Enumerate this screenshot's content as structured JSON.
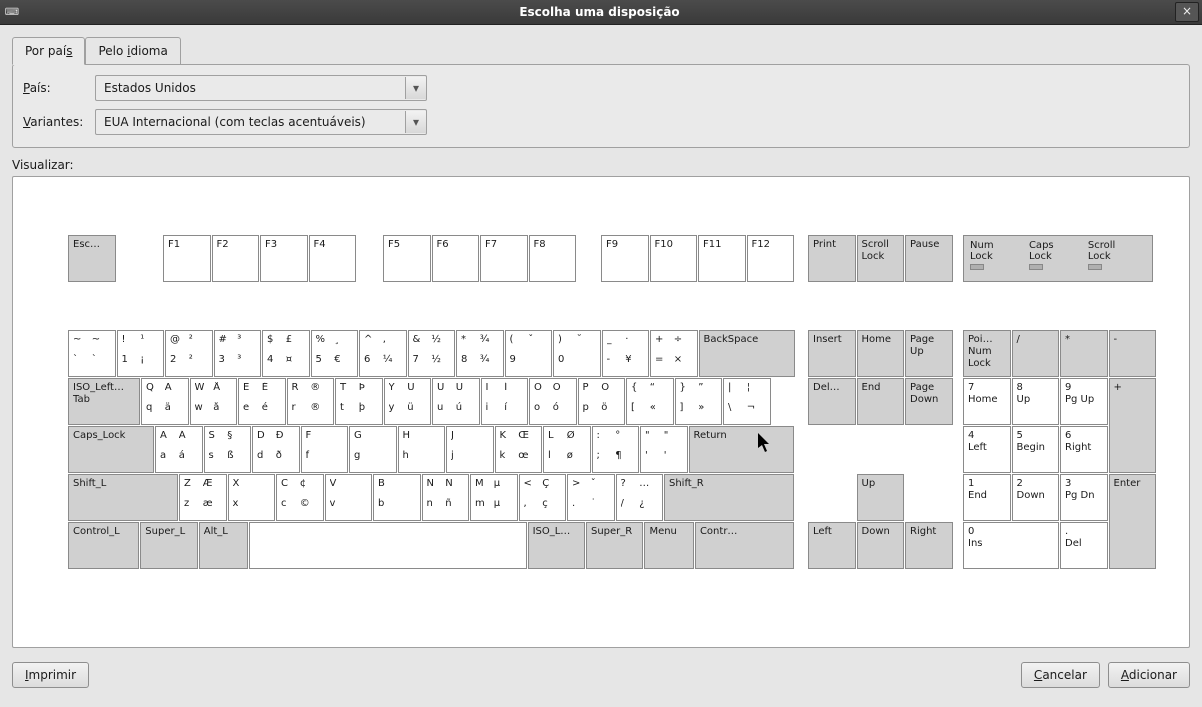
{
  "window": {
    "title": "Escolha uma disposição",
    "icon": "⌨"
  },
  "tabs": {
    "country": "Por país",
    "language": "Pelo idioma"
  },
  "form": {
    "country_label": "País:",
    "variant_label": "Variantes:",
    "country_value": "Estados Unidos",
    "variant_value": "EUA Internacional (com teclas acentuáveis)"
  },
  "preview_label": "Visualizar:",
  "lock_panel": {
    "num": "Num\nLock",
    "caps": "Caps\nLock",
    "scroll": "Scroll\nLock"
  },
  "keys": {
    "esc": "Esc…",
    "f1": "F1",
    "f2": "F2",
    "f3": "F3",
    "f4": "F4",
    "f5": "F5",
    "f6": "F6",
    "f7": "F7",
    "f8": "F8",
    "f9": "F9",
    "f10": "F10",
    "f11": "F11",
    "f12": "F12",
    "print": "Print",
    "slock": "Scroll\nLock",
    "pause": "Pause",
    "bksp": "BackSpace",
    "tab": "ISO_Left…\nTab",
    "caps": "Caps_Lock",
    "ret": "Return",
    "lshift": "Shift_L",
    "rshift": "Shift_R",
    "lctrl": "Control_L",
    "lsuper": "Super_L",
    "lalt": "Alt_L",
    "isolg": "ISO_L…",
    "rsuper": "Super_R",
    "menu": "Menu",
    "rctrl": "Contr…",
    "ins": "Insert",
    "home": "Home",
    "pgup": "Page\nUp",
    "del": "Del…",
    "end": "End",
    "pgdn": "Page\nDown",
    "up": "Up",
    "left": "Left",
    "down": "Down",
    "right": "Right",
    "numlock": "Poi…\nNum\nLock",
    "kdiv": "/",
    "kmul": "*",
    "ksub": "-",
    "kp7": "7\nHome",
    "kp8": "8\nUp",
    "kp9": "9\nPg Up",
    "kadd": "+",
    "kp4": "4\nLeft",
    "kp5": "5\nBegin",
    "kp6": "6\nRight",
    "kp1": "1\nEnd",
    "kp2": "2\nDown",
    "kp3": "3\nPg Dn",
    "kent": "Enter",
    "kp0": "0\nIns",
    "kpdot": ".\nDel"
  },
  "main_rows": {
    "r1": [
      [
        "~",
        "~",
        "`",
        "`"
      ],
      [
        "!",
        "¹",
        "1",
        "¡"
      ],
      [
        "@",
        "²",
        "2",
        "²"
      ],
      [
        "#",
        "³",
        "3",
        "³"
      ],
      [
        "$",
        "£",
        "4",
        "¤"
      ],
      [
        "%",
        "¸",
        "5",
        "€"
      ],
      [
        "^",
        ",",
        "6",
        "¼"
      ],
      [
        "&",
        "½",
        "7",
        "½"
      ],
      [
        "*",
        "¾",
        "8",
        "¾"
      ],
      [
        "(",
        "ˇ",
        "9",
        ""
      ],
      [
        ")",
        "˘",
        "0",
        ""
      ],
      [
        "_",
        "·",
        "-",
        "¥"
      ],
      [
        "+",
        "÷",
        "=",
        "×"
      ]
    ],
    "r2": [
      [
        "Q",
        "Ä",
        "q",
        "ä"
      ],
      [
        "W",
        "Å",
        "w",
        "å"
      ],
      [
        "E",
        "É",
        "e",
        "é"
      ],
      [
        "R",
        "®",
        "r",
        "®"
      ],
      [
        "T",
        "Þ",
        "t",
        "þ"
      ],
      [
        "Y",
        "Ü",
        "y",
        "ü"
      ],
      [
        "U",
        "Ú",
        "u",
        "ú"
      ],
      [
        "I",
        "Í",
        "i",
        "í"
      ],
      [
        "O",
        "Ó",
        "o",
        "ó"
      ],
      [
        "P",
        "Ö",
        "p",
        "ö"
      ],
      [
        "{",
        "“",
        "[",
        "«"
      ],
      [
        "}",
        "”",
        "]",
        "»"
      ],
      [
        "|",
        "¦",
        "\\",
        "¬"
      ]
    ],
    "r3": [
      [
        "A",
        "Á",
        "a",
        "á"
      ],
      [
        "S",
        "§",
        "s",
        "ß"
      ],
      [
        "D",
        "Ð",
        "d",
        "ð"
      ],
      [
        "F",
        "",
        "f",
        ""
      ],
      [
        "G",
        "",
        "g",
        ""
      ],
      [
        "H",
        "",
        "h",
        ""
      ],
      [
        "J",
        "",
        "j",
        ""
      ],
      [
        "K",
        "Œ",
        "k",
        "œ"
      ],
      [
        "L",
        "Ø",
        "l",
        "ø"
      ],
      [
        ":",
        "°",
        ";",
        "¶"
      ],
      [
        "\"",
        "\"",
        "'",
        "'"
      ]
    ],
    "r4": [
      [
        "Z",
        "Æ",
        "z",
        "æ"
      ],
      [
        "X",
        "",
        "x",
        ""
      ],
      [
        "C",
        "¢",
        "c",
        "©"
      ],
      [
        "V",
        "",
        "v",
        ""
      ],
      [
        "B",
        "",
        "b",
        ""
      ],
      [
        "N",
        "Ñ",
        "n",
        "ñ"
      ],
      [
        "M",
        "µ",
        "m",
        "µ"
      ],
      [
        "<",
        "Ç",
        ",",
        "ç"
      ],
      [
        ">",
        "ˇ",
        ".",
        "˙"
      ],
      [
        "?",
        "…",
        "/",
        "¿"
      ]
    ]
  },
  "buttons": {
    "print_btn": "Imprimir",
    "cancel": "Cancelar",
    "add": "Adicionar"
  }
}
